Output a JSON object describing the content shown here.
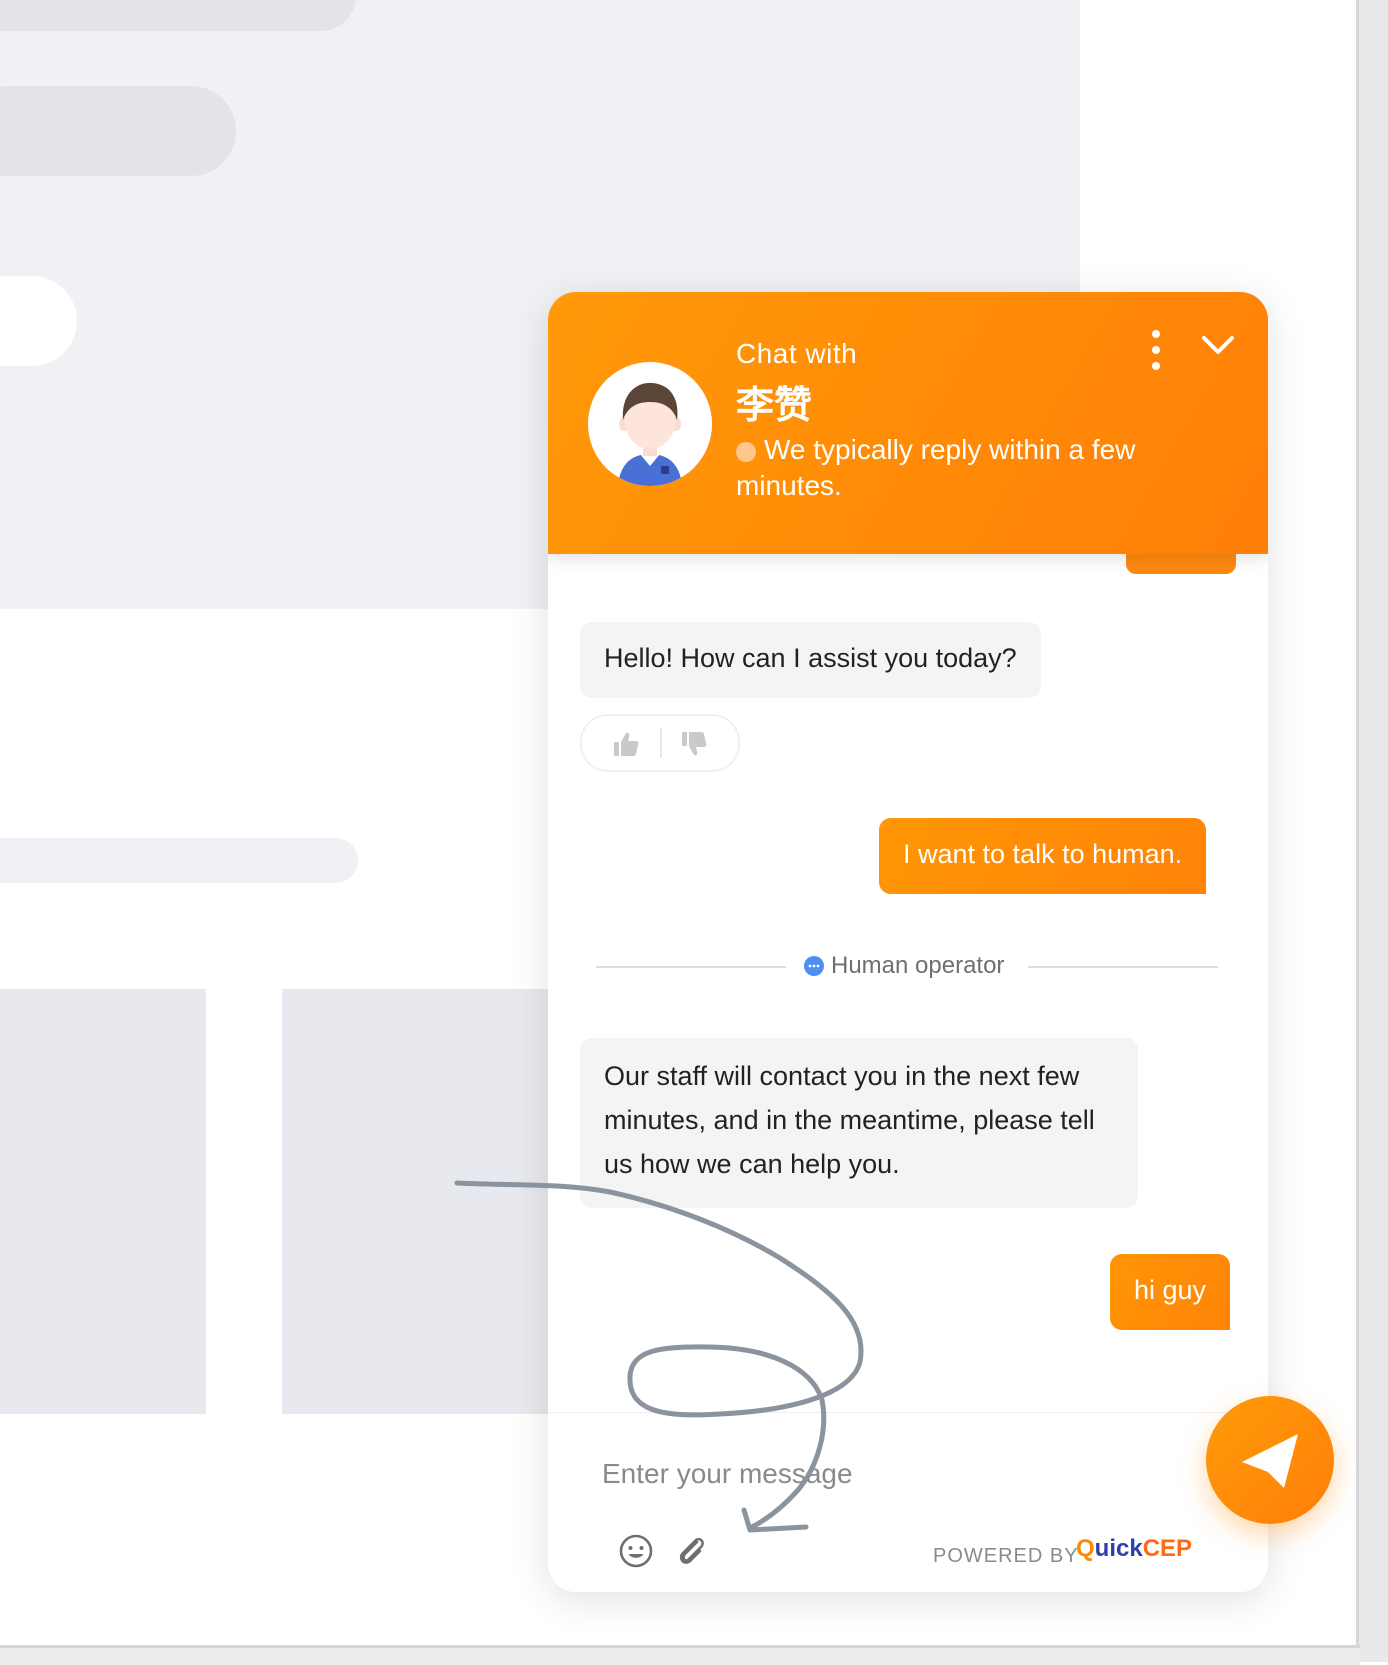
{
  "header": {
    "title": "Chat with",
    "agent_name": "李赞",
    "status_text": "We typically reply within a few minutes."
  },
  "messages": [
    {
      "from": "bot",
      "text": "Hello! How can I assist you today?"
    },
    {
      "from": "user",
      "text": "I want to talk to human."
    },
    {
      "from": "bot",
      "text": "Our staff will contact you in the next few minutes, and in the meantime, please tell us how we can help you."
    },
    {
      "from": "user",
      "text": "hi guy"
    }
  ],
  "divider": {
    "label": "Human operator"
  },
  "composer": {
    "placeholder": "Enter your message",
    "powered_by": "POWERED BY",
    "brand_q": "Q",
    "brand_uick": "uick",
    "brand_cep": "CEP"
  },
  "icons": {
    "menu": "kebab-menu-icon",
    "collapse": "chevron-down-icon",
    "like": "thumbs-up-icon",
    "dislike": "thumbs-down-icon",
    "emoji": "smiley-icon",
    "attach": "paperclip-icon",
    "send": "paper-plane-icon"
  },
  "colors": {
    "brand_orange": "#ff8a07",
    "status_dot": "#ffc78c",
    "operator_icon": "#4f8ff3",
    "bot_bubble": "#f4f4f5",
    "annotation_stroke": "#8b939e"
  }
}
